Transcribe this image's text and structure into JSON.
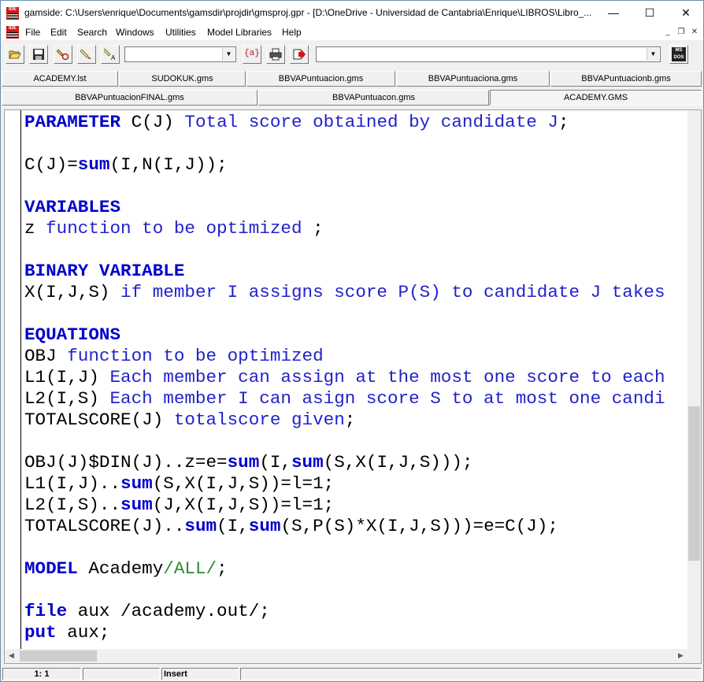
{
  "window": {
    "title": "gamside: C:\\Users\\enrique\\Documents\\gamsdir\\projdir\\gmsproj.gpr - [D:\\OneDrive - Universidad de Cantabria\\Enrique\\LIBROS\\Libro_...",
    "app_icon_text": "IDE",
    "minimize": "—",
    "maximize": "☐",
    "close": "✕"
  },
  "menu": {
    "items": [
      "File",
      "Edit",
      "Search",
      "Windows",
      "Utilities",
      "Model Libraries",
      "Help"
    ],
    "mdi_minimize": "_",
    "mdi_restore": "❐",
    "mdi_close": "✕"
  },
  "toolbar": {
    "model_combo_value": "",
    "file_combo_value": "",
    "braces_label": "{a}",
    "msdos_label": "MS DOS"
  },
  "tabs": {
    "row1": [
      "ACADEMY.lst",
      "SUDOKUK.gms",
      "BBVAPuntuacion.gms",
      "BBVAPuntuaciona.gms",
      "BBVAPuntuacionb.gms"
    ],
    "row2": [
      "BBVAPuntuacionFINAL.gms",
      "BBVAPuntuacon.gms",
      "ACADEMY.GMS"
    ],
    "active": "ACADEMY.GMS"
  },
  "editor": {
    "lines": [
      [
        {
          "t": "PARAMETER",
          "c": "kw"
        },
        {
          "t": " C(J) ",
          "c": ""
        },
        {
          "t": "Total score obtained by candidate J",
          "c": "txt"
        },
        {
          "t": ";",
          "c": ""
        }
      ],
      [],
      [
        {
          "t": "C(J)=",
          "c": ""
        },
        {
          "t": "sum",
          "c": "kw"
        },
        {
          "t": "(I,N(I,J));",
          "c": ""
        }
      ],
      [],
      [
        {
          "t": "VARIABLES",
          "c": "kw"
        }
      ],
      [
        {
          "t": "z ",
          "c": ""
        },
        {
          "t": "function to be optimized",
          "c": "txt"
        },
        {
          "t": " ;",
          "c": ""
        }
      ],
      [],
      [
        {
          "t": "BINARY VARIABLE",
          "c": "kw"
        }
      ],
      [
        {
          "t": "X(I,J,S) ",
          "c": ""
        },
        {
          "t": "if member I assigns score P(S) to candidate J takes",
          "c": "txt"
        }
      ],
      [],
      [
        {
          "t": "EQUATIONS",
          "c": "kw"
        }
      ],
      [
        {
          "t": "OBJ ",
          "c": ""
        },
        {
          "t": "function to be optimized",
          "c": "txt"
        }
      ],
      [
        {
          "t": "L1(I,J) ",
          "c": ""
        },
        {
          "t": "Each member can assign at the most one score to each",
          "c": "txt"
        }
      ],
      [
        {
          "t": "L2(I,S) ",
          "c": ""
        },
        {
          "t": "Each member I can asign score S to at most one candi",
          "c": "txt"
        }
      ],
      [
        {
          "t": "TOTALSCORE(J) ",
          "c": ""
        },
        {
          "t": "totalscore given",
          "c": "txt"
        },
        {
          "t": ";",
          "c": ""
        }
      ],
      [],
      [
        {
          "t": "OBJ(J)$DIN(J)..z=e=",
          "c": ""
        },
        {
          "t": "sum",
          "c": "kw"
        },
        {
          "t": "(I,",
          "c": ""
        },
        {
          "t": "sum",
          "c": "kw"
        },
        {
          "t": "(S,X(I,J,S)));",
          "c": ""
        }
      ],
      [
        {
          "t": "L1(I,J)..",
          "c": ""
        },
        {
          "t": "sum",
          "c": "kw"
        },
        {
          "t": "(S,X(I,J,S))=l=1;",
          "c": ""
        }
      ],
      [
        {
          "t": "L2(I,S)..",
          "c": ""
        },
        {
          "t": "sum",
          "c": "kw"
        },
        {
          "t": "(J,X(I,J,S))=l=1;",
          "c": ""
        }
      ],
      [
        {
          "t": "TOTALSCORE(J)..",
          "c": ""
        },
        {
          "t": "sum",
          "c": "kw"
        },
        {
          "t": "(I,",
          "c": ""
        },
        {
          "t": "sum",
          "c": "kw"
        },
        {
          "t": "(S,P(S)*X(I,J,S)))=e=C(J);",
          "c": ""
        }
      ],
      [],
      [
        {
          "t": "MODEL",
          "c": "kw"
        },
        {
          "t": " Academy",
          "c": ""
        },
        {
          "t": "/ALL/",
          "c": "grn"
        },
        {
          "t": ";",
          "c": ""
        }
      ],
      [],
      [
        {
          "t": "file",
          "c": "kw"
        },
        {
          "t": " aux /academy.out/;",
          "c": ""
        }
      ],
      [
        {
          "t": "put",
          "c": "kw"
        },
        {
          "t": " aux;",
          "c": ""
        }
      ]
    ]
  },
  "status": {
    "position": "1: 1",
    "panel2": "",
    "mode": "Insert",
    "panel4": ""
  },
  "colors": {
    "keyword": "#0000cc",
    "text": "#2222cc",
    "slash_text": "#2c8c2c"
  }
}
